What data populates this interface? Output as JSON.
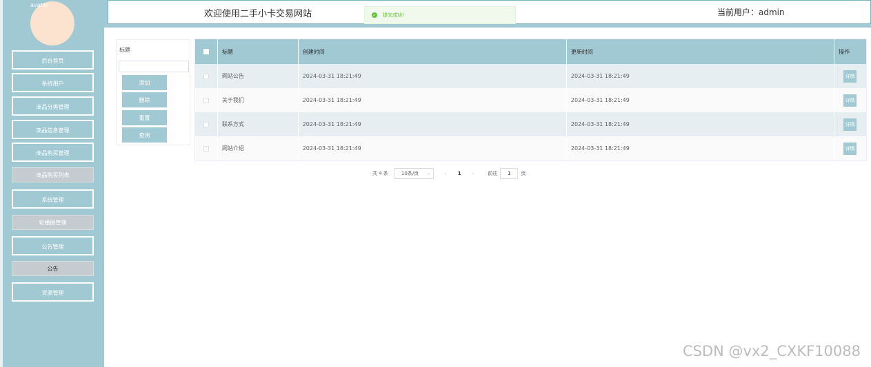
{
  "sidebar": {
    "avatar_alt": "avatar",
    "items": [
      {
        "label": "后台首页"
      },
      {
        "label": "系统用户"
      },
      {
        "label": "商品分类管理"
      },
      {
        "label": "商品信息管理"
      },
      {
        "label": "商品购买管理"
      },
      {
        "label": "商品购买列表"
      },
      {
        "label": "系统管理"
      },
      {
        "label": "轮播图管理"
      },
      {
        "label": "公告管理"
      },
      {
        "label": "公告"
      },
      {
        "label": "资源管理"
      }
    ]
  },
  "header": {
    "site_title": "欢迎使用二手小卡交易网站",
    "current_user": "当前用户：admin"
  },
  "toast": {
    "message": "提交成功!"
  },
  "search": {
    "field_label": "标题",
    "field_value": "",
    "add_label": "添加",
    "delete_label": "删除",
    "reset_label": "重置",
    "query_label": "查询"
  },
  "table": {
    "columns": [
      "标题",
      "创建时间",
      "更新时间",
      "操作"
    ],
    "rows": [
      {
        "title": "网站公告",
        "created": "2024-03-31 18:21:49",
        "updated": "2024-03-31 18:21:49",
        "action": "详情"
      },
      {
        "title": "关于我们",
        "created": "2024-03-31 18:21:49",
        "updated": "2024-03-31 18:21:49",
        "action": "详情"
      },
      {
        "title": "联系方式",
        "created": "2024-03-31 18:21:49",
        "updated": "2024-03-31 18:21:49",
        "action": "详情"
      },
      {
        "title": "网站介绍",
        "created": "2024-03-31 18:21:49",
        "updated": "2024-03-31 18:21:49",
        "action": "详情"
      }
    ]
  },
  "pagination": {
    "total": "共 4 条",
    "page_size": "10条/页",
    "current_page": "1",
    "goto_label": "前往",
    "goto_value": "1",
    "page_suffix": "页"
  },
  "watermark": "CSDN @vx2_CXKF10088",
  "colors": {
    "accent": "#a0c9d3",
    "success": "#67c23a"
  }
}
